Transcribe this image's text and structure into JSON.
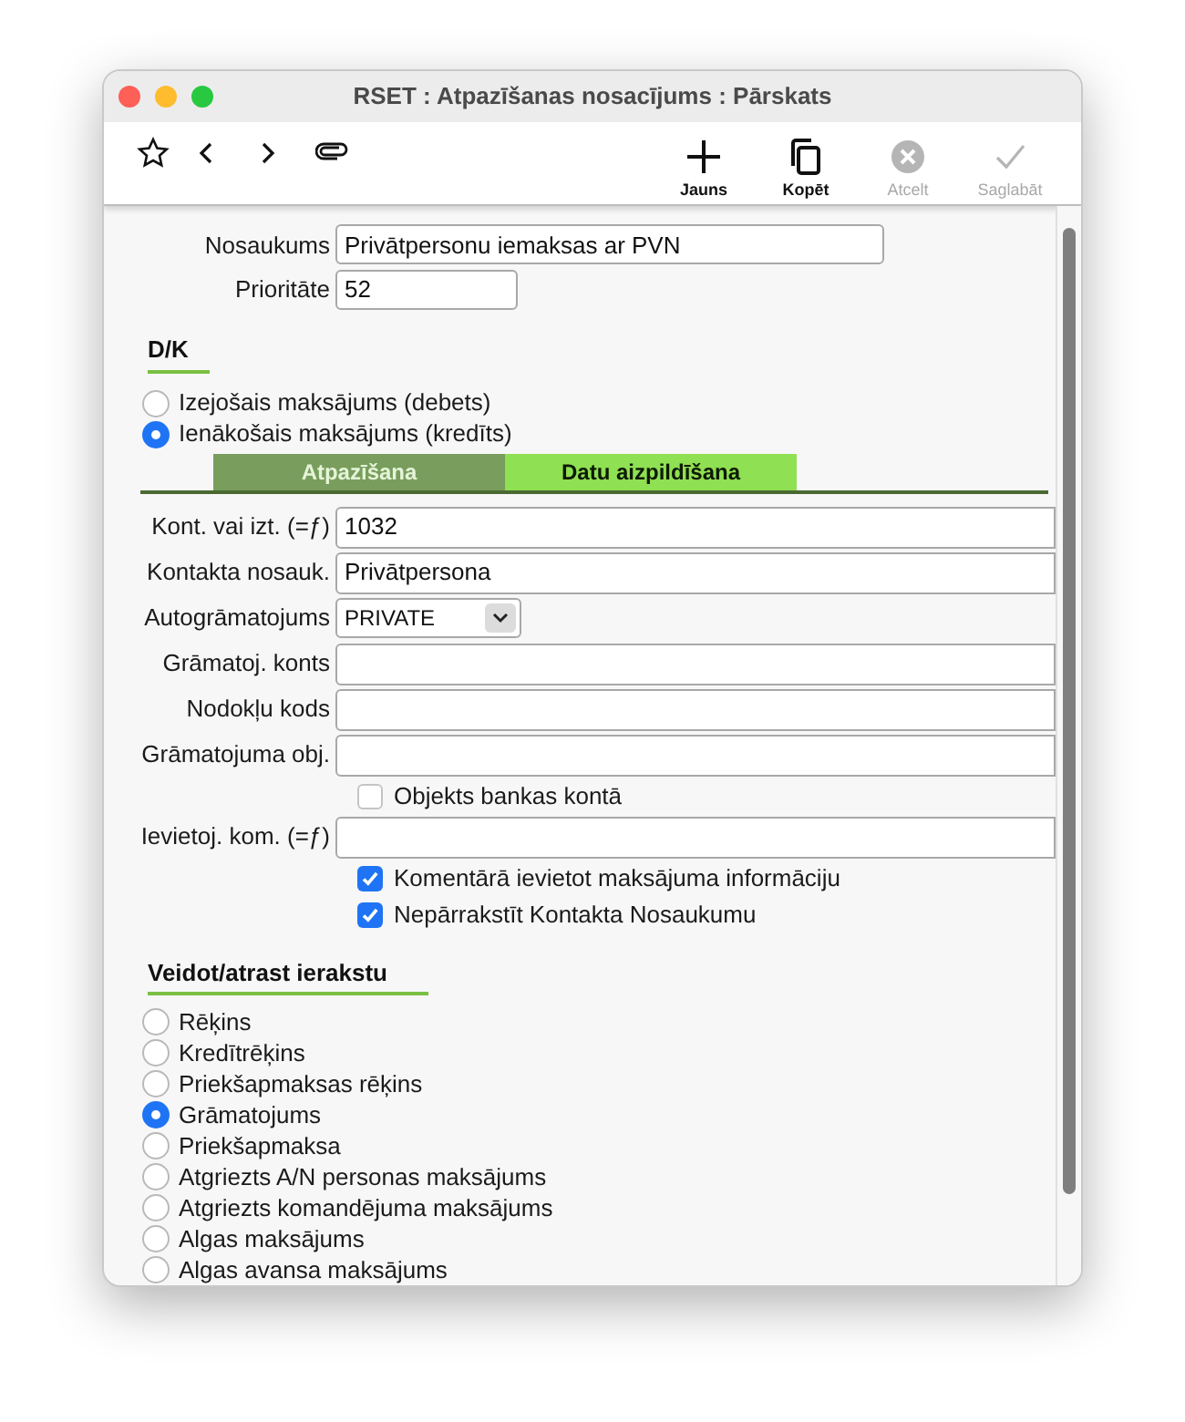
{
  "window": {
    "title": "RSET : Atpazīšanas nosacījums : Pārskats"
  },
  "toolbar": {
    "buttons": [
      {
        "kind": "new",
        "label": "Jauns",
        "disabled": false
      },
      {
        "kind": "copy",
        "label": "Kopēt",
        "disabled": false
      },
      {
        "kind": "cancel",
        "label": "Atcelt",
        "disabled": true
      },
      {
        "kind": "save",
        "label": "Saglabāt",
        "disabled": true
      }
    ]
  },
  "header_fields": [
    {
      "label": "Nosaukums",
      "value": "Privātpersonu iemaksas ar PVN",
      "kind": "wide"
    },
    {
      "label": "Prioritāte",
      "value": "52",
      "kind": "short"
    }
  ],
  "dk": {
    "title": "D/K",
    "options": [
      {
        "label": "Izejošais maksājums (debets)",
        "selected": false
      },
      {
        "label": "Ienākošais maksājums (kredīts)",
        "selected": true
      }
    ]
  },
  "tabs": [
    {
      "label": "Atpazīšana",
      "selected": false
    },
    {
      "label": "Datu aizpildīšana",
      "selected": true
    }
  ],
  "detail_rows": [
    {
      "kind": "field",
      "label": "Kont. vai izt. (=ƒ)",
      "value": "1032"
    },
    {
      "kind": "field",
      "label": "Kontakta nosauk.",
      "value": "Privātpersona"
    },
    {
      "kind": "select",
      "label": "Autogrāmatojums",
      "value": "PRIVATE"
    },
    {
      "kind": "field",
      "label": "Grāmatoj. konts"
    },
    {
      "kind": "field",
      "label": "Nodokļu kods"
    },
    {
      "kind": "field",
      "label": "Grāmatojuma obj."
    },
    {
      "kind": "checkbox",
      "label": "Objekts bankas kontā",
      "checked": false
    },
    {
      "kind": "field",
      "label": "Ievietoj. kom. (=ƒ)"
    },
    {
      "kind": "checkbox",
      "label": "Komentārā ievietot maksājuma informāciju",
      "checked": true
    },
    {
      "kind": "checkbox",
      "label": "Nepārrakstīt Kontakta Nosaukumu",
      "checked": true
    }
  ],
  "record": {
    "title": "Veidot/atrast ierakstu",
    "options": [
      {
        "label": "Rēķins",
        "selected": false
      },
      {
        "label": "Kredītrēķins",
        "selected": false
      },
      {
        "label": "Priekšapmaksas rēķins",
        "selected": false
      },
      {
        "label": "Grāmatojums",
        "selected": true
      },
      {
        "label": "Priekšapmaksa",
        "selected": false
      },
      {
        "label": "Atgriezts A/N personas maksājums",
        "selected": false
      },
      {
        "label": "Atgriezts komandējuma maksājums",
        "selected": false
      },
      {
        "label": "Algas maksājums",
        "selected": false
      },
      {
        "label": "Algas avansa maksājums",
        "selected": false
      }
    ]
  }
}
